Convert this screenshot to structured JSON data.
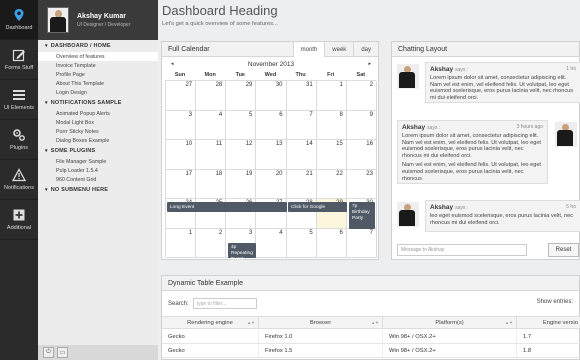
{
  "rail": [
    {
      "label": "Dashboard",
      "icon": "location-pin-icon",
      "active": true
    },
    {
      "label": "Forms Stuff",
      "icon": "edit-icon",
      "active": false
    },
    {
      "label": "UI Elements",
      "icon": "list-icon",
      "active": false
    },
    {
      "label": "Plugins",
      "icon": "gears-icon",
      "active": false
    },
    {
      "label": "Notifications",
      "icon": "warning-icon",
      "active": false
    },
    {
      "label": "Additional",
      "icon": "plus-icon",
      "active": false
    }
  ],
  "profile": {
    "name": "Akshay Kumar",
    "role": "UI Designer / Developer"
  },
  "nav": {
    "sections": [
      {
        "title": "DASHBOARD / HOME",
        "items": [
          "Overview of features",
          "Invoice Template",
          "Profile Page",
          "About This Template",
          "Login Design"
        ]
      },
      {
        "title": "NOTIFICATIONS SAMPLE",
        "items": [
          "Animated Popup Alerts",
          "Modal Light Box",
          "Purrr Sticky Notes",
          "Dialog Boxes Example"
        ]
      },
      {
        "title": "SOME PLUGINS",
        "items": [
          "File Manager Sample",
          "Pulp Loader 1.5.4",
          "960 Content Grid"
        ]
      },
      {
        "title": "NO SUBMENU HERE",
        "items": []
      }
    ]
  },
  "page": {
    "heading": "Dashboard Heading",
    "subheading": "Let's get a quick overview of some features..."
  },
  "calendar": {
    "title": "Full Calendar",
    "views": [
      "month",
      "week",
      "day"
    ],
    "month": "November 2013",
    "prev": "◂",
    "next": "▸",
    "dow": [
      "Sun",
      "Mon",
      "Tue",
      "Wed",
      "Thu",
      "Fri",
      "Sat"
    ],
    "weeks": [
      [
        "27",
        "28",
        "29",
        "30",
        "31",
        "1",
        "2"
      ],
      [
        "3",
        "4",
        "5",
        "6",
        "7",
        "8",
        "9"
      ],
      [
        "10",
        "11",
        "12",
        "13",
        "14",
        "15",
        "16"
      ],
      [
        "17",
        "18",
        "19",
        "20",
        "21",
        "22",
        "23"
      ],
      [
        "24",
        "25",
        "26",
        "27",
        "28",
        "29",
        "30"
      ],
      [
        "1",
        "2",
        "3",
        "4",
        "5",
        "6",
        "7"
      ]
    ],
    "events": {
      "long_event": "Long Event",
      "click_google": "Click for Google",
      "birthday": "7p Birthday Party",
      "repeating": "4p Repeating Event"
    }
  },
  "chat": {
    "title": "Chatting Layout",
    "messages": [
      {
        "name": "Akshay",
        "says": "says :",
        "time": "1 ho",
        "text": "Lorem ipsum dolor sit amet, consectetur adipiscing elit. Nam vel est enim, vel eleifend felis. Ut volutpat, leo eget euismod scelerisque, eros purus lacinia velit, nec rhoncus mi dui eleifend orci."
      },
      {
        "name": "Akshay",
        "says": "says :",
        "time": "3 hours ago",
        "text": "Lorem ipsum dolor sit amet, consectetur adipiscing elit. Nam vel est enim, vel eleifend felis. Ut volutpat, leo eget euismod scelerisque, eros purus lacinia velit, nec rhoncus mi dui eleifend orci.",
        "text2": "Nam vel est enim, vel eleifend felis. Ut volutpat, leo eget euismod scelerisque, eros purus lacinia velit, nec rhoncus"
      },
      {
        "name": "Akshay",
        "says": "says :",
        "time": "5 ho",
        "text": "leo eget euismod scelerisque, eros purus lacinia velit, nec rhoncus mi dui eleifend orci."
      }
    ],
    "input_placeholder": "Message to Akshay",
    "reset_label": "Reset"
  },
  "table": {
    "title": "Dynamic Table Example",
    "search_label": "Search:",
    "search_placeholder": "type to filter...",
    "show_entries": "Show entries:",
    "columns": [
      "Rendering engine",
      "Browser",
      "Platform(s)",
      "Engine versio"
    ],
    "rows": [
      [
        "Gecko",
        "Firefox 1.0",
        "Win 98+ / OSX.2+",
        "1.7"
      ],
      [
        "Gecko",
        "Firefox 1.5",
        "Win 98+ / OSX.2+",
        "1.8"
      ]
    ]
  }
}
